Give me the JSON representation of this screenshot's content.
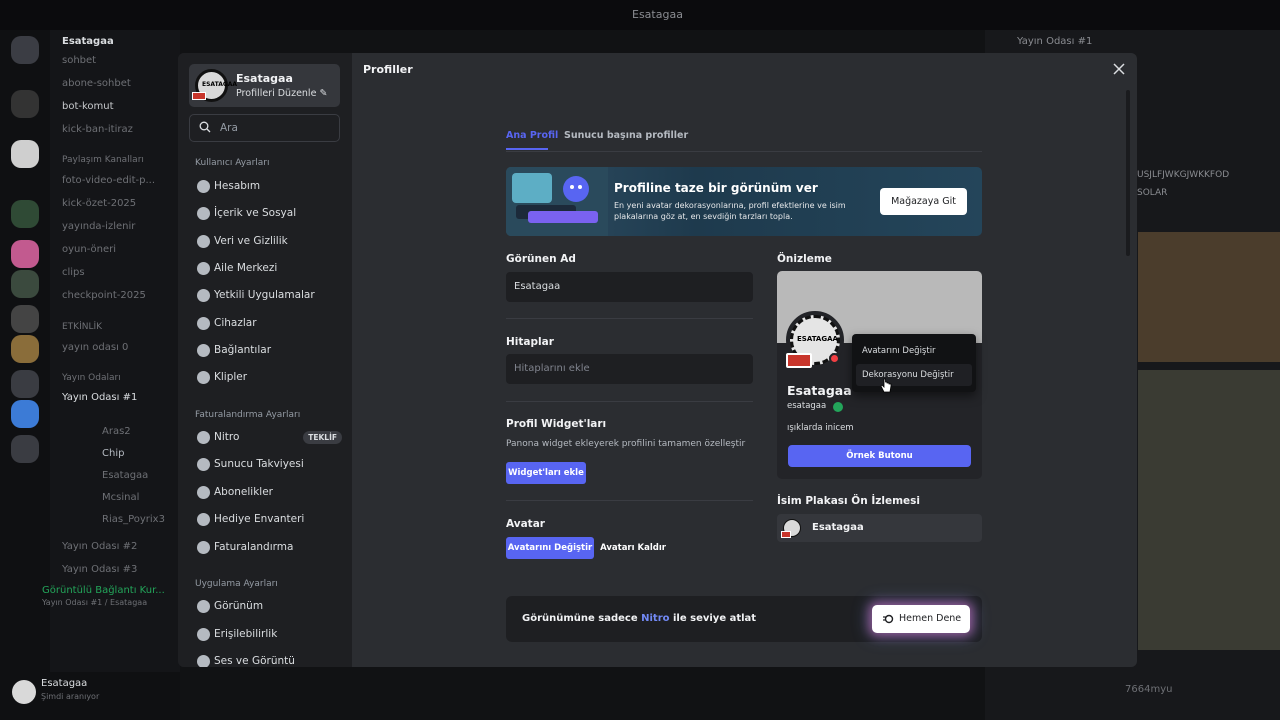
{
  "background": {
    "window_title": "Esatagaa",
    "server_name": "Esatagaa",
    "channels": [
      "sohbet",
      "abone-sohbet",
      "bot-komut",
      "kick-ban-itiraz",
      "Paylaşım Kanalları",
      "foto-video-edit-p...",
      "kick-özet-2025",
      "yayında-izlenir",
      "oyun-öneri",
      "clips",
      "checkpoint-2025",
      "ETKİNLİK",
      "yayın odası 0",
      "Yayın Odaları",
      "Yayın Odası #1",
      "Aras2",
      "Chip",
      "Esatagaa",
      "Mcsinal",
      "Rias_Poyrix3",
      "Yayın Odası #2",
      "Yayın Odası #3"
    ],
    "voice_status": "Görüntülü Bağlantı Kur...",
    "voice_sub": "Yayın Odası #1 / Esatagaa",
    "user_name": "Esatagaa",
    "user_status": "Şimdi aranıyor",
    "right_header": "Yayın Odası #1",
    "right_text_1": "USJLFJWKGJWKKFOD",
    "right_text_2": "SOLAR",
    "right_footer": "7664myu"
  },
  "sidebar": {
    "profile_name": "Esatagaa",
    "profile_edit": "Profilleri Düzenle",
    "avatar_text": "ESATAGAA",
    "search_placeholder": "Ara",
    "section_user": "Kullanıcı Ayarları",
    "user_items": [
      {
        "label": "Hesabım",
        "icon": "user-icon"
      },
      {
        "label": "İçerik ve Sosyal",
        "icon": "content-icon"
      },
      {
        "label": "Veri ve Gizlilik",
        "icon": "shield-icon"
      },
      {
        "label": "Aile Merkezi",
        "icon": "family-icon"
      },
      {
        "label": "Yetkili Uygulamalar",
        "icon": "apps-icon"
      },
      {
        "label": "Cihazlar",
        "icon": "devices-icon"
      },
      {
        "label": "Bağlantılar",
        "icon": "link-icon"
      },
      {
        "label": "Klipler",
        "icon": "clips-icon"
      }
    ],
    "section_billing": "Faturalandırma Ayarları",
    "billing_items": [
      {
        "label": "Nitro",
        "icon": "nitro-icon",
        "badge": "TEKLİF"
      },
      {
        "label": "Sunucu Takviyesi",
        "icon": "boost-icon"
      },
      {
        "label": "Abonelikler",
        "icon": "subscriptions-icon"
      },
      {
        "label": "Hediye Envanteri",
        "icon": "gift-icon"
      },
      {
        "label": "Faturalandırma",
        "icon": "card-icon"
      }
    ],
    "section_app": "Uygulama Ayarları",
    "app_items": [
      {
        "label": "Görünüm",
        "icon": "palette-icon"
      },
      {
        "label": "Erişilebilirlik",
        "icon": "accessibility-icon"
      },
      {
        "label": "Ses ve Görüntü",
        "icon": "mic-icon"
      }
    ]
  },
  "main": {
    "title": "Profiller",
    "tabs": [
      "Ana Profil",
      "Sunucu başına profiller"
    ],
    "banner": {
      "title": "Profiline taze bir görünüm ver",
      "subtitle": "En yeni avatar dekorasyonlarına, profil efektlerine ve isim plakalarına göz at, en sevdiğin tarzları topla.",
      "button": "Mağazaya Git"
    },
    "display_name_label": "Görünen Ad",
    "display_name_value": "Esatagaa",
    "pronouns_label": "Hitaplar",
    "pronouns_placeholder": "Hitaplarını ekle",
    "widgets_label": "Profil Widget'ları",
    "widgets_sub": "Panona widget ekleyerek profilini tamamen özelleştir",
    "widgets_button": "Widget'ları ekle",
    "avatar_label": "Avatar",
    "avatar_change": "Avatarını Değiştir",
    "avatar_remove": "Avatarı Kaldır",
    "preview_label": "Önizleme",
    "preview": {
      "avatar_text": "ESATAGAA",
      "name": "Esatagaa",
      "username": "esatagaa",
      "status": "ışıklarda inicem",
      "button": "Örnek Butonu"
    },
    "context_menu": [
      "Avatarını Değiştir",
      "Dekorasyonu Değiştir"
    ],
    "nameplate_label": "İsim Plakası Ön İzlemesi",
    "nameplate_name": "Esatagaa",
    "upsell_prefix": "Görünümüne sadece",
    "upsell_nitro": "Nitro",
    "upsell_suffix": "ile seviye atlat",
    "upsell_button": "Hemen Dene"
  },
  "colors": {
    "accent": "#5865f2",
    "modal_bg": "#2b2d31",
    "sidebar_bg": "#1e1f22",
    "dnd": "#f23f43"
  }
}
